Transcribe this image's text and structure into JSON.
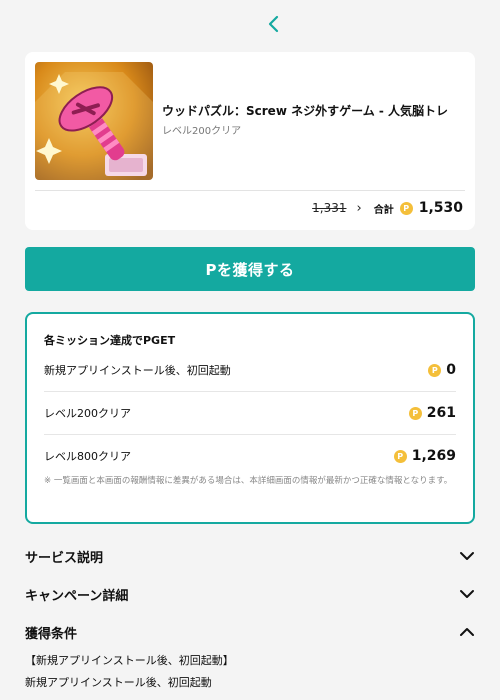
{
  "nav": {
    "back_icon": "chevron-left-icon"
  },
  "app": {
    "title": "ウッドパズル：Screw ネジ外すゲーム - 人気脳トレ",
    "subtitle": "レベル200クリア",
    "old_price": "1,331",
    "total_label": "合計",
    "total_value": "1,530",
    "coin_symbol": "P"
  },
  "cta": {
    "label": "Pを獲得する"
  },
  "missions": {
    "heading": "各ミッション達成でPGET",
    "items": [
      {
        "label": "新規アプリインストール後、初回起動",
        "points": "0"
      },
      {
        "label": "レベル200クリア",
        "points": "261"
      },
      {
        "label": "レベル800クリア",
        "points": "1,269"
      }
    ],
    "note": "※ 一覧画面と本画面の報酬情報に差異がある場合は、本詳細画面の情報が最新かつ正確な情報となります。"
  },
  "sections": {
    "service": {
      "title": "サービス説明"
    },
    "campaign": {
      "title": "キャンペーン詳細"
    },
    "conditions": {
      "title": "獲得条件",
      "line1": "【新規アプリインストール後、初回起動】",
      "line2": "新規アプリインストール後、初回起動"
    }
  },
  "colors": {
    "accent": "#14a9a0",
    "coin": "#f4bf3a",
    "background": "#f4f4f4"
  }
}
